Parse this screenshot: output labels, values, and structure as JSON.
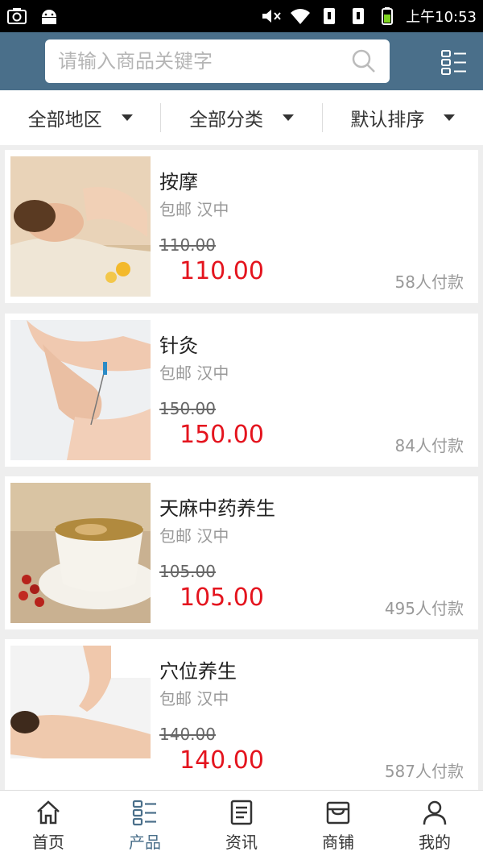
{
  "status": {
    "time": "上午10:53"
  },
  "search": {
    "placeholder": "请输入商品关键字"
  },
  "filters": [
    {
      "label": "全部地区"
    },
    {
      "label": "全部分类"
    },
    {
      "label": "默认排序"
    }
  ],
  "products": [
    {
      "title": "按摩",
      "tags": "包邮 汉中",
      "original_price": "110.00",
      "price": "110.00",
      "sold": "58人付款",
      "image": "massage-photo"
    },
    {
      "title": "针灸",
      "tags": "包邮 汉中",
      "original_price": "150.00",
      "price": "150.00",
      "sold": "84人付款",
      "image": "acupuncture-photo"
    },
    {
      "title": "天麻中药养生",
      "tags": "包邮 汉中",
      "original_price": "105.00",
      "price": "105.00",
      "sold": "495人付款",
      "image": "herbal-soup-photo"
    },
    {
      "title": "穴位养生",
      "tags": "包邮 汉中",
      "original_price": "140.00",
      "price": "140.00",
      "sold": "587人付款",
      "image": "back-massage-photo"
    }
  ],
  "nav": [
    {
      "label": "首页",
      "icon": "home-icon"
    },
    {
      "label": "产品",
      "icon": "products-icon",
      "active": true
    },
    {
      "label": "资讯",
      "icon": "news-icon"
    },
    {
      "label": "商铺",
      "icon": "shop-icon"
    },
    {
      "label": "我的",
      "icon": "user-icon"
    }
  ],
  "colors": {
    "header": "#4a6f8a",
    "price": "#e4141e"
  }
}
